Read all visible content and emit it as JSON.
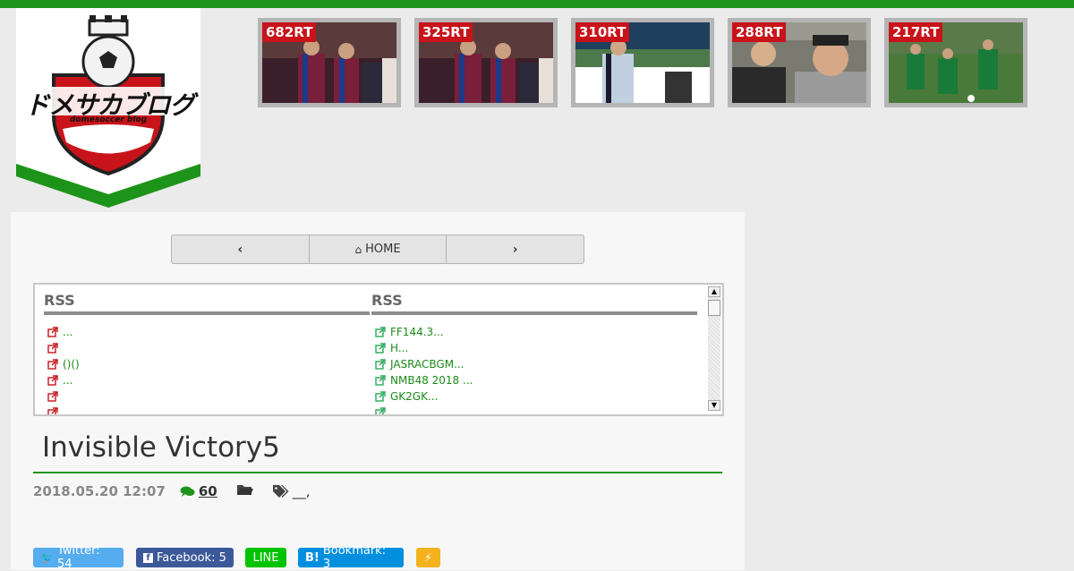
{
  "logo": {
    "title": "ドメサカブログ",
    "subtitle": "domesoccer blog"
  },
  "thumbnails": [
    {
      "rt": "682RT"
    },
    {
      "rt": "325RT"
    },
    {
      "rt": "310RT"
    },
    {
      "rt": "288RT"
    },
    {
      "rt": "217RT"
    }
  ],
  "nav": {
    "prev": "<",
    "home": "HOME",
    "next": ">"
  },
  "rss": {
    "left": {
      "header": "RSS",
      "items": [
        "...",
        "",
        "()()",
        "...",
        "",
        ""
      ]
    },
    "right": {
      "header": "RSS",
      "items": [
        "FF144.3...",
        "H...",
        "JASRACBGM...",
        "NMB48 2018 ...",
        "GK2GK...",
        ""
      ]
    }
  },
  "article": {
    "title": "Invisible Victory5",
    "date": "2018.05.20 12:07",
    "comments": "60",
    "tags": "__,"
  },
  "share": {
    "twitter": "Twitter: 54",
    "facebook": "Facebook: 5",
    "line": "LINE",
    "bookmark": "Bookmark: 3"
  },
  "colors": {
    "accent_green": "#1d9419",
    "rt_red": "#c8131a",
    "twitter": "#55acee",
    "facebook": "#3b5998",
    "line": "#00c300",
    "hatena": "#008fde",
    "pocket": "#f5b21f"
  }
}
